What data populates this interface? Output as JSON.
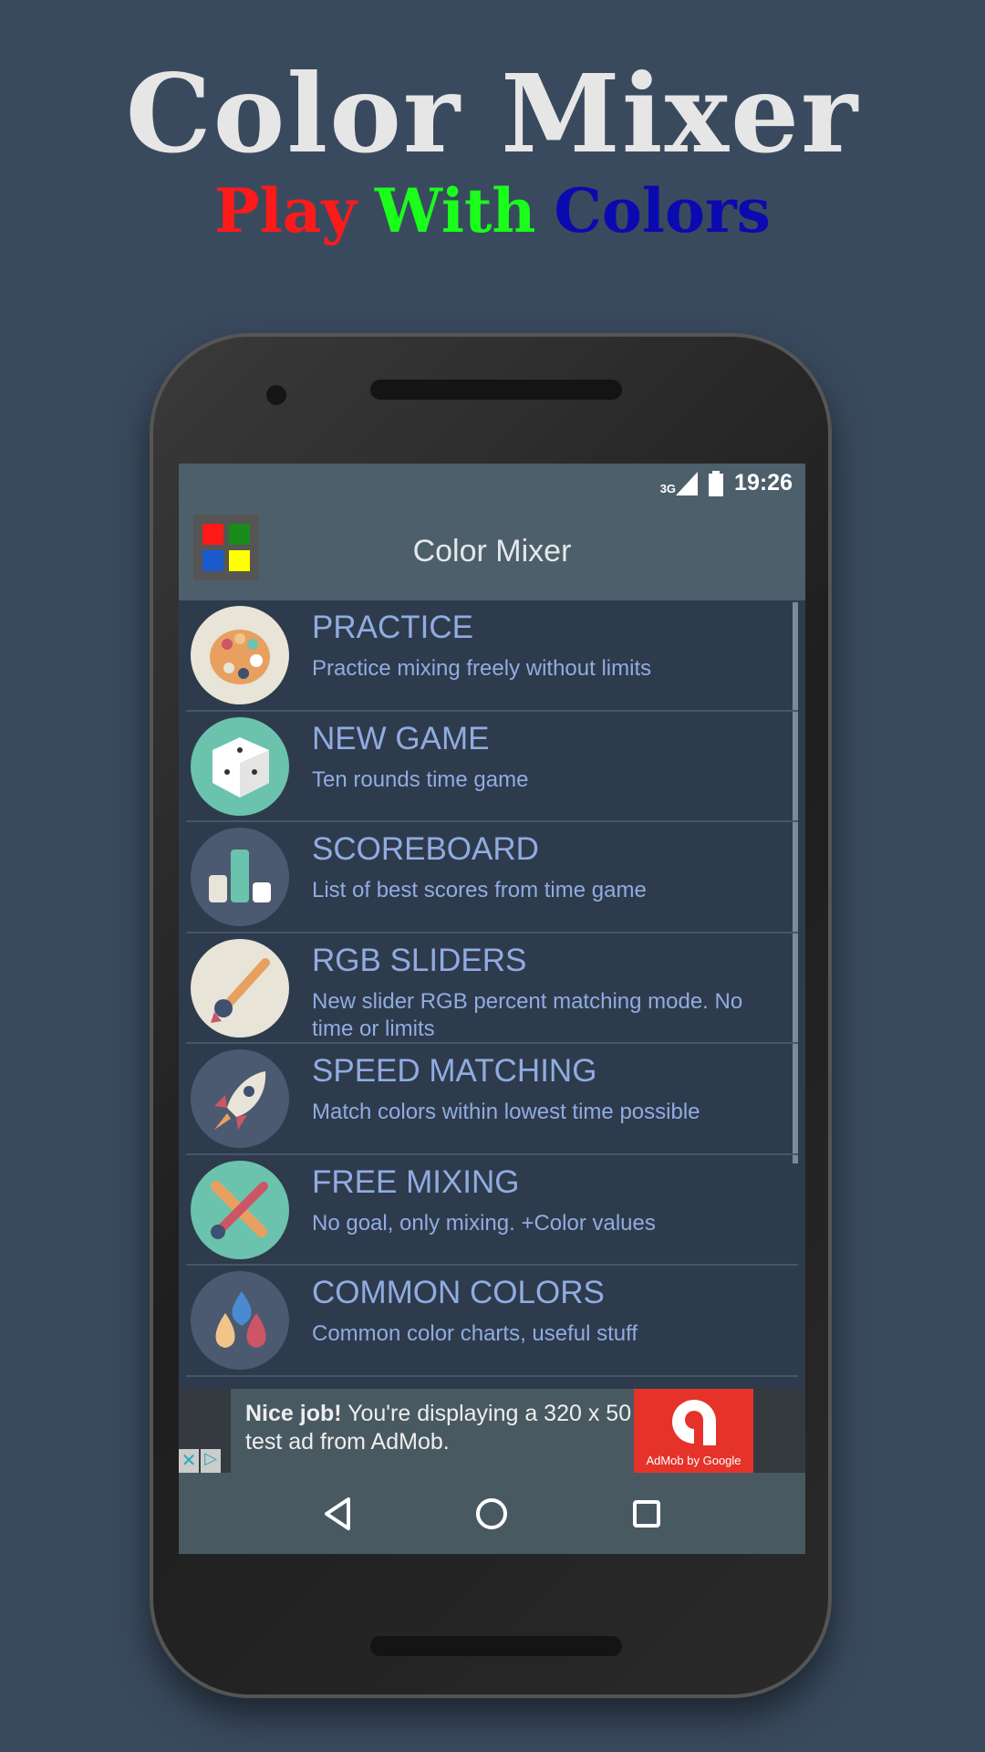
{
  "promo": {
    "title": "Color Mixer",
    "subtitle": [
      {
        "text": "Play",
        "color": "#ff1a1a"
      },
      {
        "text": "With",
        "color": "#1aff1a"
      },
      {
        "text": "Colors",
        "color": "#0a0ab0"
      }
    ]
  },
  "status": {
    "network": "3G",
    "time": "19:26"
  },
  "toolbar": {
    "title": "Color Mixer",
    "logo_colors": [
      "#ff1a1a",
      "#1a8a1a",
      "#1a5acc",
      "#ffff00"
    ]
  },
  "menu": [
    {
      "title": "PRACTICE",
      "desc": "Practice mixing freely without limits",
      "icon": "palette-icon",
      "bg": "#e8e4d8"
    },
    {
      "title": "NEW GAME",
      "desc": "Ten rounds time game",
      "icon": "dice-icon",
      "bg": "#6cc3ad"
    },
    {
      "title": "SCOREBOARD",
      "desc": "List of best scores from time game",
      "icon": "bar-chart-icon",
      "bg": "#4b5a70"
    },
    {
      "title": "RGB SLIDERS",
      "desc": "New slider RGB percent matching mode. No time or limits",
      "icon": "paintbrush-icon",
      "bg": "#e8e4d8"
    },
    {
      "title": "SPEED MATCHING",
      "desc": "Match colors within lowest time possible",
      "icon": "rocket-icon",
      "bg": "#4b5a70"
    },
    {
      "title": "FREE MIXING",
      "desc": "No goal, only mixing. +Color values",
      "icon": "brush-pencil-icon",
      "bg": "#6cc3ad"
    },
    {
      "title": "COMMON COLORS",
      "desc": "Common color charts, useful stuff",
      "icon": "drops-icon",
      "bg": "#4b5a70"
    }
  ],
  "ad": {
    "bold": "Nice job!",
    "text": " You're displaying a 320 x 50 test ad from AdMob.",
    "brand": "AdMob by Google"
  }
}
